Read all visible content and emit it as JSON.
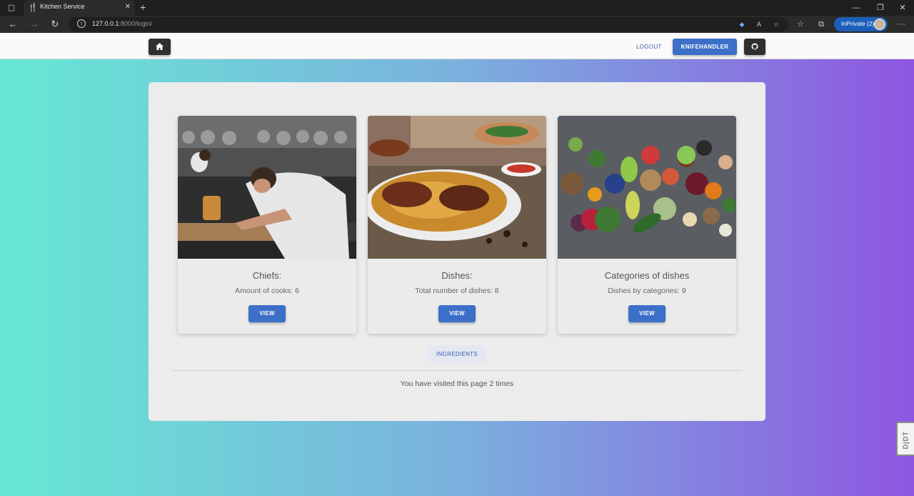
{
  "browser": {
    "tab_title": "Kitchen Service",
    "url_host": "127.0.0.1",
    "url_rest": ":8000/login/",
    "inprivate_label": "InPrivate (2)"
  },
  "nav": {
    "logout_label": "LOGOUT",
    "username_label": "KNIFEHANDLER"
  },
  "cards": [
    {
      "title": "Chiefs:",
      "text": "Amount of cooks: 6",
      "button": "VIEW"
    },
    {
      "title": "Dishes:",
      "text": "Total number of dishes: 8",
      "button": "VIEW"
    },
    {
      "title": "Categories of dishes",
      "text": "Dishes by categories: 9",
      "button": "VIEW"
    }
  ],
  "ingredients_label": "INGREDIENTS",
  "visits_text": "You have visited this page 2 times",
  "debug_toolbar_label": "DjDT",
  "colors": {
    "primary": "#3c6fc7",
    "gradient_start": "#66e8d4",
    "gradient_end": "#8e56e0",
    "panel": "#ececec"
  }
}
